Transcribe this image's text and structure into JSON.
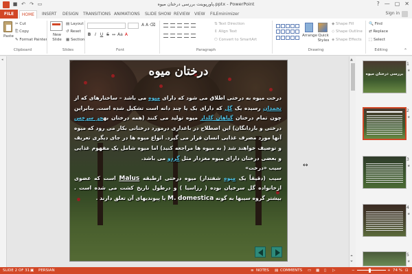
{
  "window": {
    "title": "پاورپوینت بررسی درختان میوه.pptx - PowerPoint",
    "controls": [
      "?",
      "—",
      "▢",
      "✕"
    ],
    "signin": "Sign in"
  },
  "tabs": [
    "FILE",
    "HOME",
    "INSERT",
    "DESIGN",
    "TRANSITIONS",
    "ANIMATIONS",
    "SLIDE SHOW",
    "REVIEW",
    "VIEW",
    "FILEminimizer"
  ],
  "ribbon": {
    "clipboard": {
      "paste": "Paste",
      "cut": "Cut",
      "copy": "Copy",
      "format_painter": "Format Painter",
      "label": "Clipboard"
    },
    "slides": {
      "new_slide": "New Slide",
      "layout": "Layout",
      "reset": "Reset",
      "section": "Section",
      "label": "Slides"
    },
    "font": {
      "label": "Font"
    },
    "paragraph": {
      "text_direction": "Text Direction",
      "align_text": "Align Text",
      "convert_smartart": "Convert to SmartArt",
      "label": "Paragraph"
    },
    "drawing": {
      "arrange": "Arrange",
      "quick_styles": "Quick Styles",
      "shape_fill": "Shape Fill",
      "shape_outline": "Shape Outline",
      "shape_effects": "Shape Effects",
      "label": "Drawing"
    },
    "editing": {
      "find": "Find",
      "replace": "Replace",
      "select": "Select",
      "label": "Editing"
    }
  },
  "slide": {
    "title": "درختان میوه",
    "para1_a": "درخت میوه به درختی اطلاق می شود که دارای ",
    "para1_link1": "میوه",
    "para1_b": " می باشد – ساختارهای که از ",
    "para1_link2": "تخمدان",
    "para1_c": " رسیده یک ",
    "para1_link3": "گل",
    "para1_d": " که دارای یک یا چند دانه است تشکیل شده است. بنابراین چون تمام درختان ",
    "para1_link4": "گیاهان گلدار",
    "para1_e": " میوه تولید می کنند (همه درختان به",
    "para1_link5": "جز سرخس",
    "para1_f": " درختی و بازدانگان) این اصطلاح در باغداری درمورد درختانی بکار می رود که میوه آنها مورد مصرف غذایی انسان قرار می گیرد. انواع میوه ها در جای دیگری تعریف و توصیف خواهند شد ( به میوه ها مراجعه کنید) اما میوه شامل یک مفهوم غذایی و بعضی درختان دارای میوه مغزدار مثل ",
    "para1_link6": "گردو",
    "para1_g": " می باشد.",
    "para2": "سیب «درخت»",
    "para3_a": "سیب (دقیقاً یک ",
    "para3_link": "میوه",
    "para3_b": " شفتدار) میوه درختی ازطبقه ",
    "para3_malus": "Malus",
    "para3_c": " است که عضوی ازخانواده گل سرخیان بوده ( رزاسیا ) و درطول تاریخ کشت می شده است . بیشتر گروه سیبها به گونه ",
    "para3_m": "M.",
    "para3_domestica": "domestica",
    "para3_d": " یا پیوندیهای آن تعلق دارند ."
  },
  "thumbnails": [
    {
      "num": "1",
      "title": "بررسی درختان میوه"
    },
    {
      "num": "2",
      "title": ""
    },
    {
      "num": "3",
      "title": ""
    },
    {
      "num": "4",
      "title": ""
    },
    {
      "num": "5",
      "title": ""
    }
  ],
  "status": {
    "slide_info": "SLIDE 2 OF 31",
    "language": "PERSIAN",
    "notes": "NOTES",
    "comments": "COMMENTS",
    "zoom": "74 %"
  },
  "colors": {
    "accent": "#d24726",
    "link": "#4fc3e8",
    "nav": "#2d8a7a"
  },
  "current_slide": 2
}
